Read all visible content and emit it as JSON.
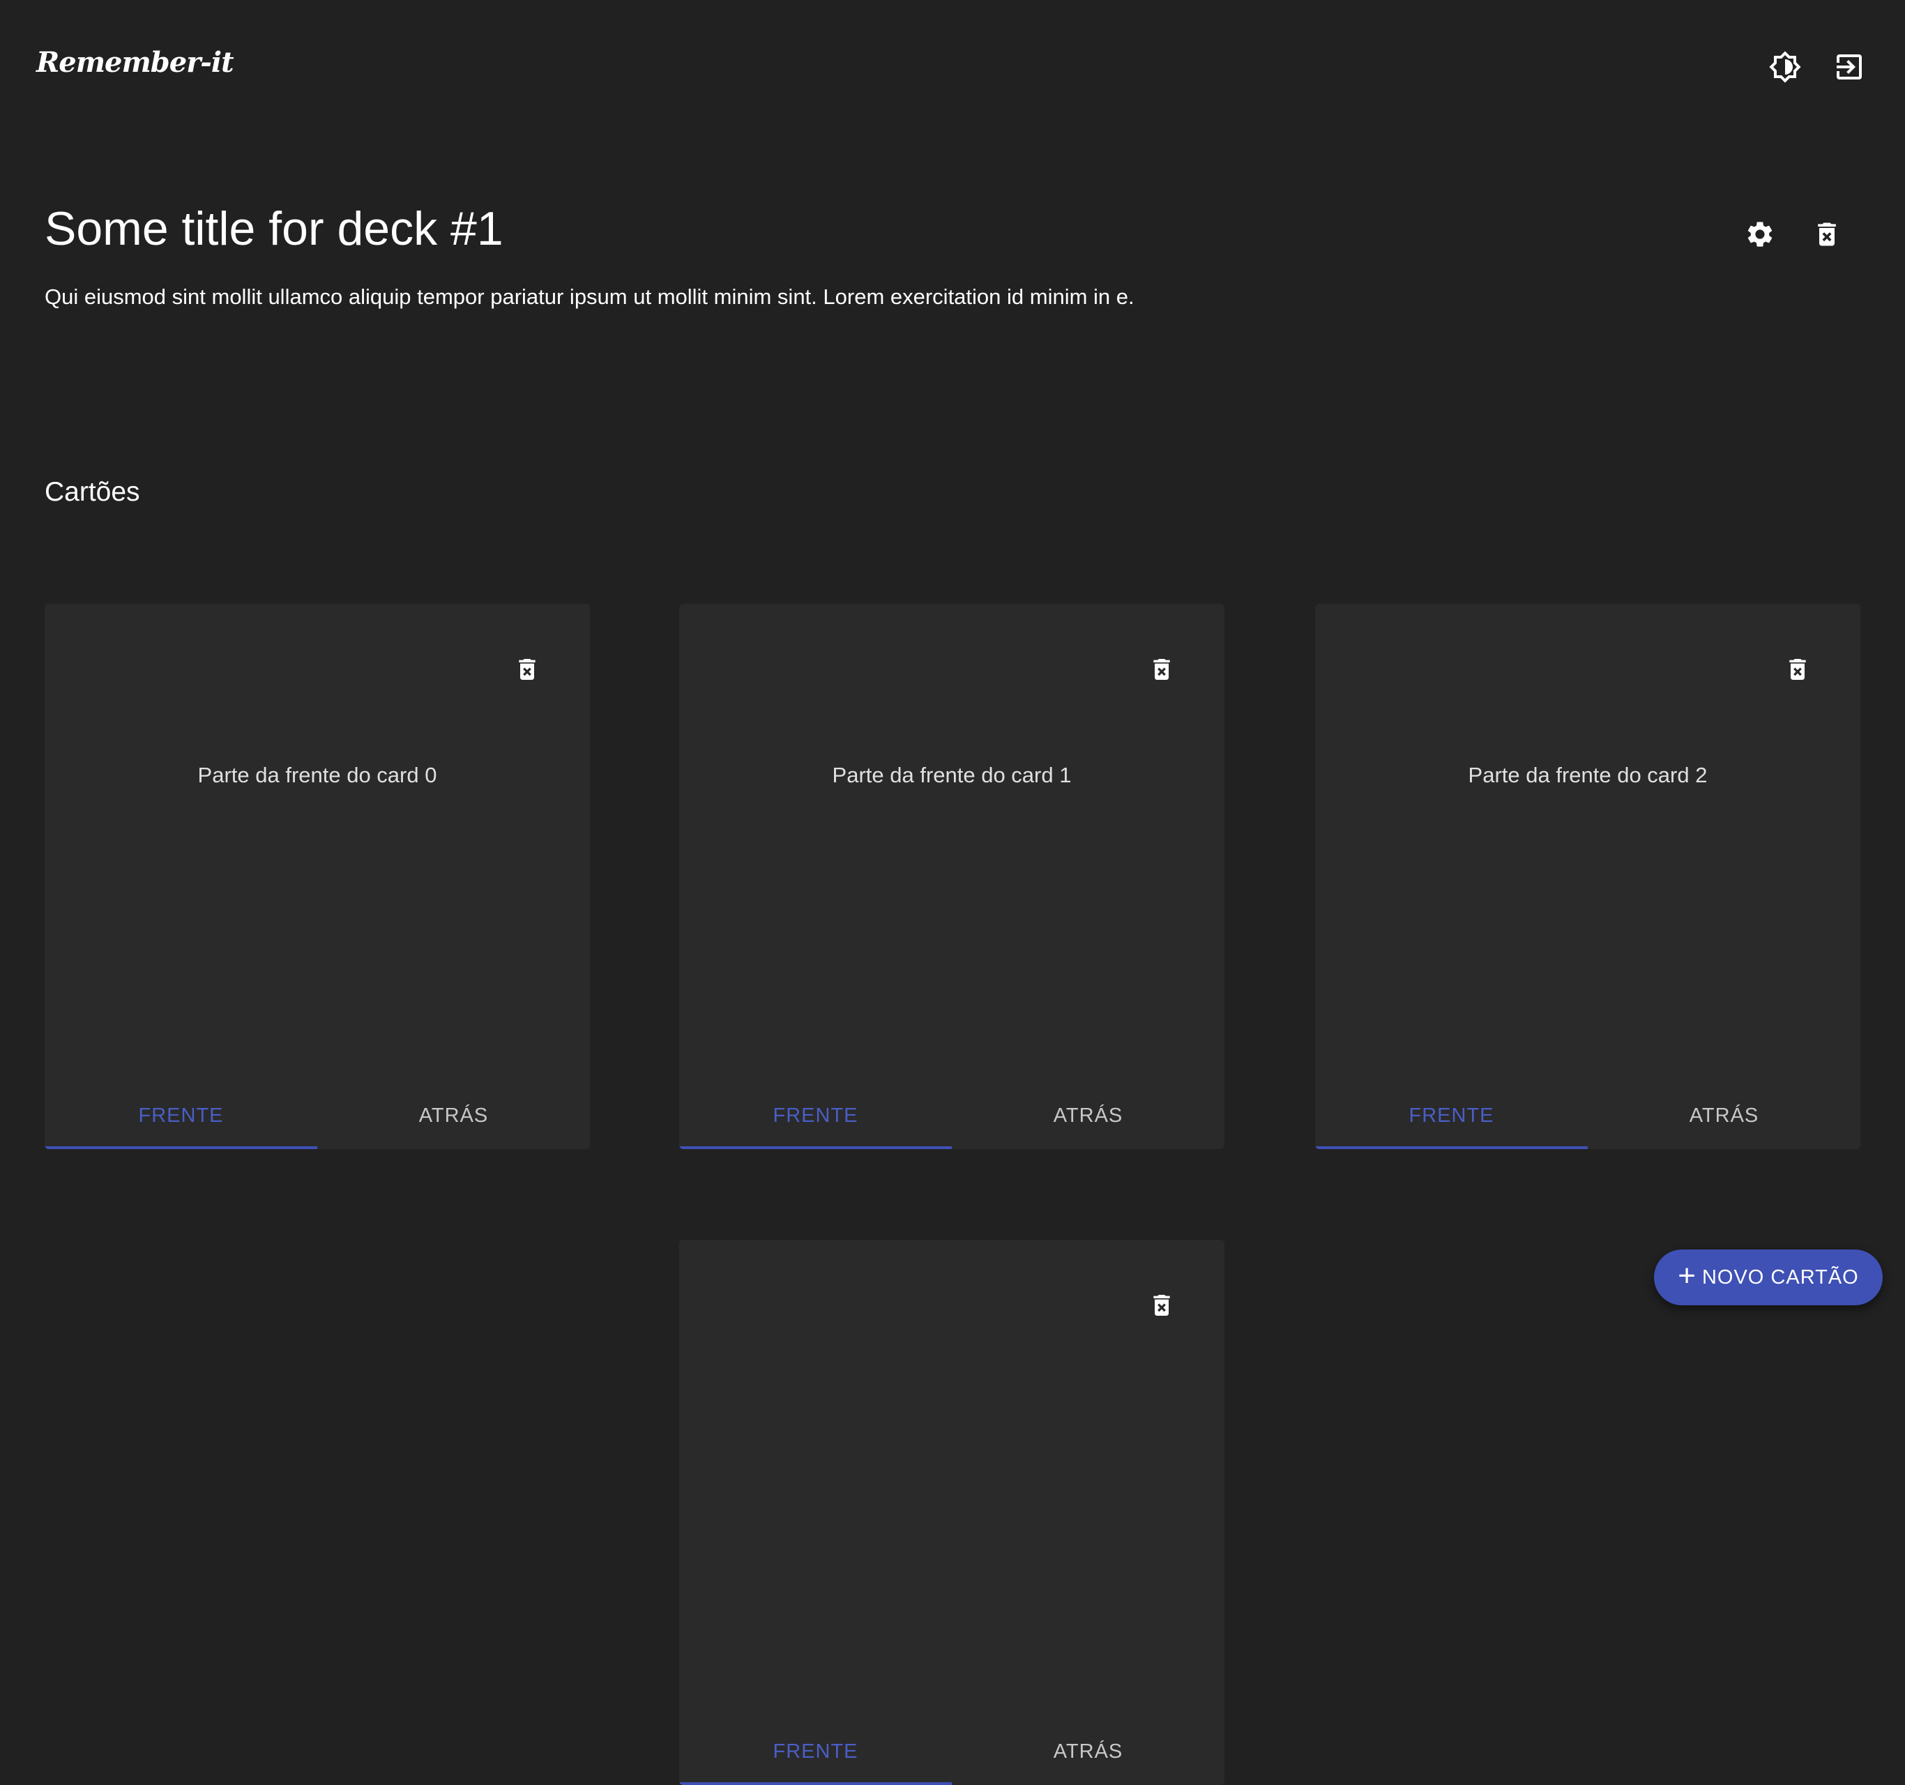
{
  "app": {
    "brand": "Remember-it",
    "theme_toggle_icon": "brightness-icon",
    "logout_icon": "logout-icon"
  },
  "deck": {
    "title": "Some title for deck #1",
    "description": "Qui eiusmod sint mollit ullamco aliquip tempor pariatur ipsum ut mollit minim sint. Lorem exercitation id minim in e.",
    "settings_icon": "gear-icon",
    "delete_icon": "trash-icon"
  },
  "cards_section": {
    "title": "Cartões"
  },
  "cards": [
    {
      "front_text": "Parte da frente do card 0",
      "tab_front": "FRENTE",
      "tab_back": "ATRÁS",
      "active_tab": "front"
    },
    {
      "front_text": "Parte da frente do card 1",
      "tab_front": "FRENTE",
      "tab_back": "ATRÁS",
      "active_tab": "front"
    },
    {
      "front_text": "Parte da frente do card 2",
      "tab_front": "FRENTE",
      "tab_back": "ATRÁS",
      "active_tab": "front"
    },
    {
      "front_text": "",
      "tab_front": "FRENTE",
      "tab_back": "ATRÁS",
      "active_tab": "front"
    }
  ],
  "fab": {
    "icon": "+",
    "label": "NOVO CARTÃO"
  },
  "colors": {
    "background": "#212121",
    "card": "#2a2a2b",
    "accent": "#3f51b5"
  }
}
